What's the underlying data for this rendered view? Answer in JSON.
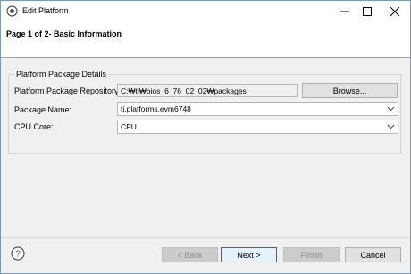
{
  "window": {
    "title": "Edit Platform"
  },
  "header": {
    "title": "Page 1 of 2- Basic Information"
  },
  "details": {
    "group_title": "Platform Package Details",
    "repository_label": "Platform Package Repository:",
    "repository_value": "C:₩ti₩bios_6_76_02_02₩packages",
    "browse_label": "Browse...",
    "package_name_label": "Package Name:",
    "package_name_value": "ti.platforms.evm6748",
    "cpu_core_label": "CPU Core:",
    "cpu_core_value": "CPU"
  },
  "footer": {
    "back_label": "< Back",
    "next_label": "Next >",
    "finish_label": "Finish",
    "cancel_label": "Cancel"
  },
  "icons": {
    "app": "eclipse-icon",
    "help": "help-icon"
  }
}
